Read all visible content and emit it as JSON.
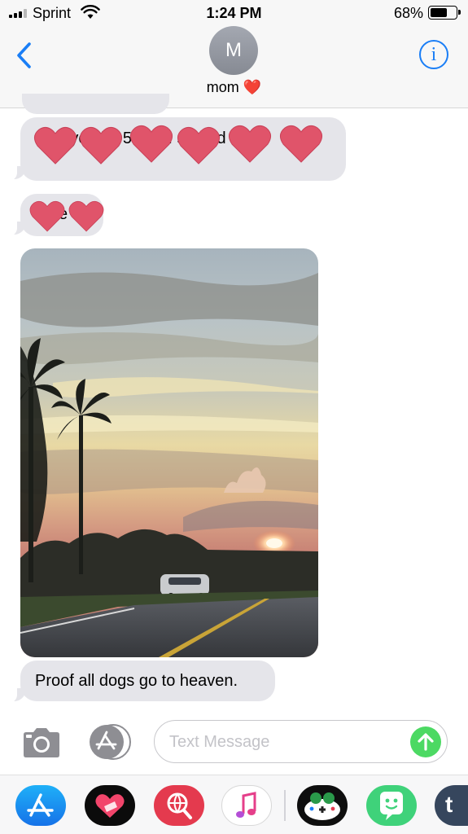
{
  "status_bar": {
    "carrier": "Sprint",
    "time": "1:24 PM",
    "battery_percent": "68%",
    "battery_level": 0.68,
    "signal_bars_filled": 3,
    "signal_bars_total": 4
  },
  "header": {
    "avatar_initial": "M",
    "contact_name": "mom ❤️",
    "info_label": "i",
    "accent_color": "#1a7ef6"
  },
  "messages": [
    {
      "type": "text",
      "direction": "incoming",
      "text": "ng if you im 59 m... s good",
      "obscured_by": "heart stickers"
    },
    {
      "type": "text",
      "direction": "incoming",
      "text": "e",
      "obscured_by": "heart stickers"
    },
    {
      "type": "image",
      "direction": "incoming",
      "subject": "sunset over a road with palm trees and a dog-shaped cloud"
    },
    {
      "type": "text",
      "direction": "incoming",
      "text": "Proof all dogs go to heaven."
    }
  ],
  "input": {
    "placeholder": "Text Message",
    "value": "",
    "send_color": "#4cd963"
  },
  "icons": {
    "back": "chevron-left-icon",
    "info": "info-icon",
    "camera": "camera-icon",
    "app_store": "app-store-icon",
    "send": "arrow-up-icon"
  },
  "app_drawer": [
    {
      "name": "App Store",
      "icon": "app-store-icon"
    },
    {
      "name": "Heart app",
      "icon": "heart-app-icon"
    },
    {
      "name": "Web search",
      "icon": "globe-search-icon"
    },
    {
      "name": "Music",
      "icon": "music-note-icon"
    },
    {
      "name": "Game",
      "icon": "game-controller-icon"
    },
    {
      "name": "Bitmoji",
      "icon": "smiley-bubble-icon"
    },
    {
      "name": "Tumblr",
      "icon": "tumblr-icon",
      "label": "t"
    }
  ]
}
